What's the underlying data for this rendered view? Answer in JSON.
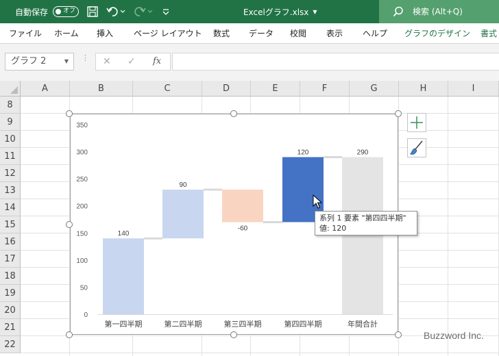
{
  "titlebar": {
    "autosave_label": "自動保存",
    "autosave_state": "オフ",
    "filename": "Excelグラフ.xlsx",
    "search_label": "検索 (Alt+Q)",
    "bg_color": "#217346"
  },
  "ribbon": {
    "tabs": [
      "ファイル",
      "ホーム",
      "挿入",
      "ページ レイアウト",
      "数式",
      "データ",
      "校閲",
      "表示",
      "ヘルプ",
      "グラフのデザイン",
      "書式"
    ]
  },
  "formula_bar": {
    "name_box": "グラフ 2",
    "fx_label": "fx",
    "cancel_symbol": "✕",
    "enter_symbol": "✓"
  },
  "sheet": {
    "columns": [
      "A",
      "B",
      "C",
      "D",
      "E",
      "F",
      "G",
      "H",
      "I"
    ],
    "rows": [
      "8",
      "9",
      "10",
      "11",
      "12",
      "13",
      "14",
      "15",
      "16",
      "17",
      "18",
      "19",
      "20",
      "21",
      "22"
    ]
  },
  "chart_data": {
    "type": "bar",
    "subtype": "waterfall",
    "categories": [
      "第一四半期",
      "第二四半期",
      "第三四半期",
      "第四四半期",
      "年間合計"
    ],
    "values": [
      140,
      90,
      -60,
      120,
      290
    ],
    "value_labels": [
      "140",
      "90",
      "-60",
      "120",
      "290"
    ],
    "ylim": [
      0,
      350
    ],
    "yticks": [
      "0",
      "50",
      "100",
      "150",
      "200",
      "250",
      "300",
      "350"
    ],
    "grid": false,
    "legend": "none",
    "colors": {
      "increase": "#c9d6ef",
      "decrease": "#f9d5c1",
      "total": "#e4e4e4",
      "selected": "#4472c4",
      "connector": "#d9d9d9"
    },
    "selected_index": 3
  },
  "tooltip": {
    "line1": "系列 1 要素 \"第四四半期\"",
    "line2": "値: 120"
  },
  "watermark": "Buzzword Inc."
}
